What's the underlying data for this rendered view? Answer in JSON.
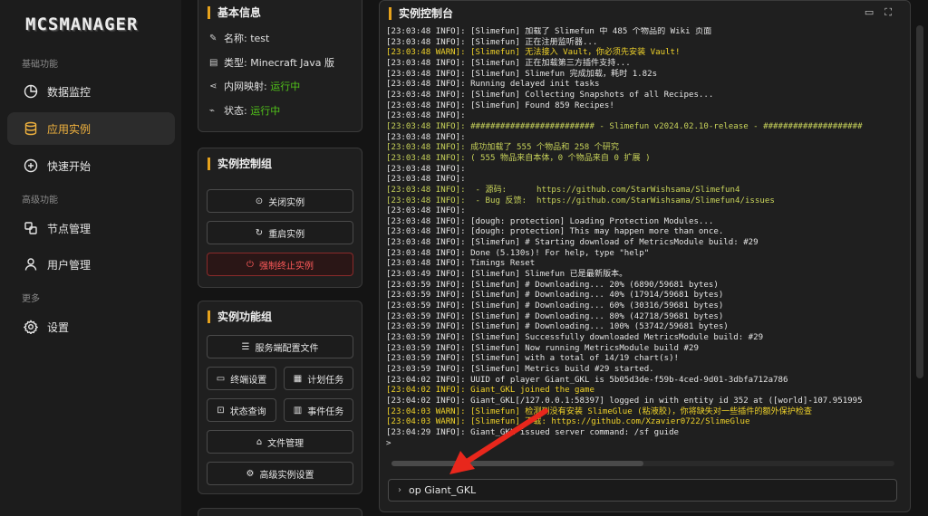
{
  "app": {
    "logo": "MCSMANAGER"
  },
  "sidebar": {
    "sections": [
      {
        "label": "基础功能"
      },
      {
        "label": "高级功能"
      },
      {
        "label": "更多"
      }
    ],
    "items": [
      {
        "label": "数据监控",
        "icon": "dashboard-icon"
      },
      {
        "label": "应用实例",
        "icon": "database-icon",
        "active": true
      },
      {
        "label": "快速开始",
        "icon": "plus-circle-icon"
      },
      {
        "label": "节点管理",
        "icon": "nodes-icon"
      },
      {
        "label": "用户管理",
        "icon": "user-icon"
      },
      {
        "label": "设置",
        "icon": "gear-icon"
      }
    ]
  },
  "info": {
    "title": "基本信息",
    "name_label": "名称:",
    "name_value": "test",
    "type_label": "类型:",
    "type_value": "Minecraft Java 版",
    "net_label": "内网映射:",
    "net_value": "运行中",
    "status_label": "状态:",
    "status_value": "运行中"
  },
  "control": {
    "title": "实例控制组",
    "close": "关闭实例",
    "restart": "重启实例",
    "kill": "强制终止实例"
  },
  "features": {
    "title": "实例功能组",
    "server_config": "服务端配置文件",
    "terminal_settings": "终端设置",
    "scheduled_tasks": "计划任务",
    "status_query": "状态查询",
    "event_tasks": "事件任务",
    "file_manager": "文件管理",
    "advanced_settings": "高级实例设置"
  },
  "console": {
    "title": "实例控制台",
    "lines": [
      {
        "text": "[23:03:48 INFO]: [Slimefun] 加载了 Slimefun 中 485 个物品的 Wiki 页面",
        "c": ""
      },
      {
        "text": "[23:03:48 INFO]: [Slimefun] 正在注册监听器...",
        "c": ""
      },
      {
        "text": "[23:03:48 WARN]: [Slimefun] 无法接入 Vault，你必须先安装 Vault!",
        "c": "y"
      },
      {
        "text": "[23:03:48 INFO]: [Slimefun] 正在加载第三方插件支持...",
        "c": ""
      },
      {
        "text": "[23:03:48 INFO]: [Slimefun] Slimefun 完成加载，耗时 1.82s",
        "c": ""
      },
      {
        "text": "[23:03:48 INFO]: Running delayed init tasks",
        "c": ""
      },
      {
        "text": "[23:03:48 INFO]: [Slimefun] Collecting Snapshots of all Recipes...",
        "c": ""
      },
      {
        "text": "[23:03:48 INFO]: [Slimefun] Found 859 Recipes!",
        "c": ""
      },
      {
        "text": "[23:03:48 INFO]:",
        "c": ""
      },
      {
        "text": "[23:03:48 INFO]: ######################### - Slimefun v2024.02.10-release - ####################",
        "c": "g"
      },
      {
        "text": "[23:03:48 INFO]:",
        "c": ""
      },
      {
        "text": "[23:03:48 INFO]: 成功加载了 555 个物品和 258 个研究",
        "c": "g"
      },
      {
        "text": "[23:03:48 INFO]: ( 555 物品来自本体，0 个物品来自 0 扩展 )",
        "c": "g"
      },
      {
        "text": "[23:03:48 INFO]:",
        "c": ""
      },
      {
        "text": "[23:03:48 INFO]:",
        "c": ""
      },
      {
        "text": "[23:03:48 INFO]:  - 源码:      https://github.com/StarWishsama/Slimefun4",
        "c": "g"
      },
      {
        "text": "[23:03:48 INFO]:  - Bug 反馈:  https://github.com/StarWishsama/Slimefun4/issues",
        "c": "g"
      },
      {
        "text": "[23:03:48 INFO]:",
        "c": ""
      },
      {
        "text": "[23:03:48 INFO]: [dough: protection] Loading Protection Modules...",
        "c": ""
      },
      {
        "text": "[23:03:48 INFO]: [dough: protection] This may happen more than once.",
        "c": ""
      },
      {
        "text": "[23:03:48 INFO]: [Slimefun] # Starting download of MetricsModule build: #29",
        "c": ""
      },
      {
        "text": "[23:03:48 INFO]: Done (5.130s)! For help, type \"help\"",
        "c": ""
      },
      {
        "text": "[23:03:48 INFO]: Timings Reset",
        "c": ""
      },
      {
        "text": "[23:03:49 INFO]: [Slimefun] Slimefun 已是最新版本。",
        "c": ""
      },
      {
        "text": "[23:03:59 INFO]: [Slimefun] # Downloading... 20% (6890/59681 bytes)",
        "c": ""
      },
      {
        "text": "[23:03:59 INFO]: [Slimefun] # Downloading... 40% (17914/59681 bytes)",
        "c": ""
      },
      {
        "text": "[23:03:59 INFO]: [Slimefun] # Downloading... 60% (30316/59681 bytes)",
        "c": ""
      },
      {
        "text": "[23:03:59 INFO]: [Slimefun] # Downloading... 80% (42718/59681 bytes)",
        "c": ""
      },
      {
        "text": "[23:03:59 INFO]: [Slimefun] # Downloading... 100% (53742/59681 bytes)",
        "c": ""
      },
      {
        "text": "[23:03:59 INFO]: [Slimefun] Successfully downloaded MetricsModule build: #29",
        "c": ""
      },
      {
        "text": "[23:03:59 INFO]: [Slimefun] Now running MetricsModule build #29",
        "c": ""
      },
      {
        "text": "[23:03:59 INFO]: [Slimefun] with a total of 14/19 chart(s)!",
        "c": ""
      },
      {
        "text": "[23:03:59 INFO]: [Slimefun] Metrics build #29 started.",
        "c": ""
      },
      {
        "text": "[23:04:02 INFO]: UUID of player Giant_GKL is 5b05d3de-f59b-4ced-9d01-3dbfa712a786",
        "c": ""
      },
      {
        "text": "[23:04:02 INFO]: Giant_GKL joined the game",
        "c": "y"
      },
      {
        "text": "[23:04:02 INFO]: Giant_GKL[/127.0.0.1:58397] logged in with entity id 352 at ([world]-107.951995",
        "c": ""
      },
      {
        "text": "[23:04:03 WARN]: [Slimefun] 检测到没有安装 SlimeGlue (粘液胶)，你将缺失对一些插件的额外保护检查",
        "c": "y"
      },
      {
        "text": "[23:04:03 WARN]: [Slimefun] 下载: https://github.com/Xzavier0722/SlimeGlue",
        "c": "y"
      },
      {
        "text": "[23:04:29 INFO]: Giant_GKL issued server command: /sf guide",
        "c": ""
      },
      {
        "text": ">",
        "c": ""
      }
    ],
    "input_value": "op Giant_GKL"
  }
}
